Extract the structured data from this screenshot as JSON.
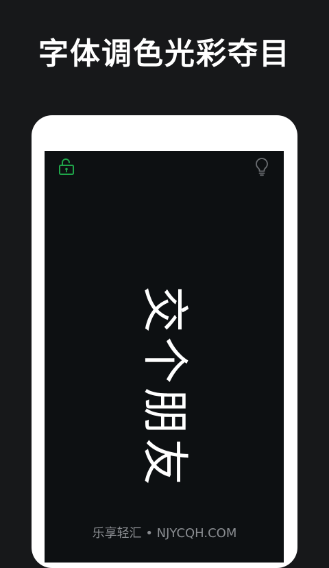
{
  "headline": "字体调色光彩夺目",
  "display_text": "交个朋友",
  "icons": {
    "lock": "unlock-icon",
    "bulb": "lightbulb-icon"
  },
  "colors": {
    "background": "#17181a",
    "screen": "#0d1012",
    "lock": "#1fa64a",
    "bulb": "#6b6e72",
    "text": "#ffffff"
  },
  "watermark": "乐享轻汇 • NJYCQH.COM"
}
